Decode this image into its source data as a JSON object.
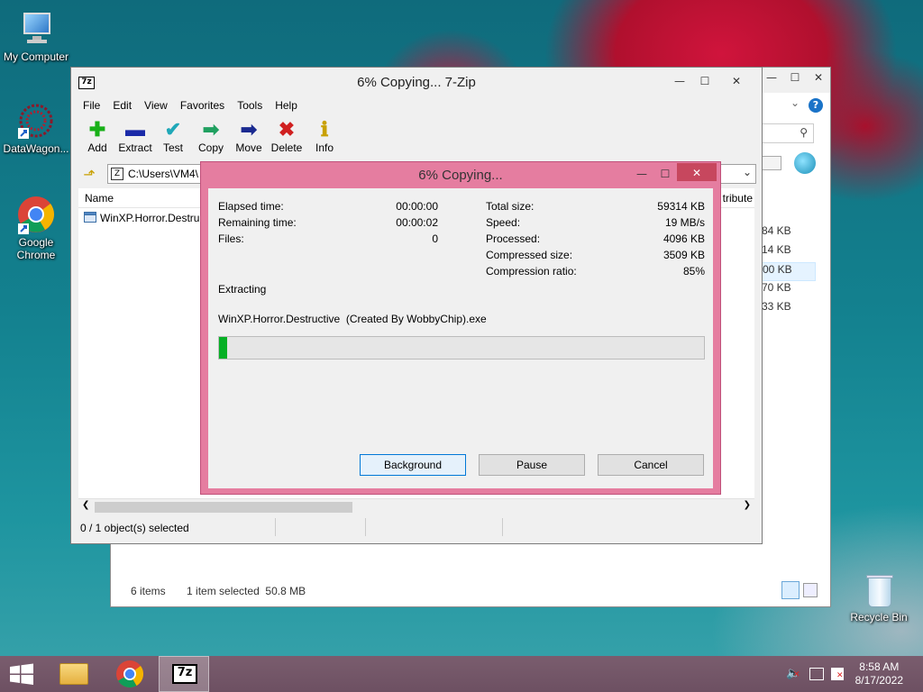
{
  "desktop": {
    "icons": [
      {
        "label": "My Computer"
      },
      {
        "label": "DataWagon..."
      },
      {
        "label": "Google Chrome"
      },
      {
        "label": "Recycle Bin"
      }
    ]
  },
  "explorer": {
    "sizes": [
      "84 KB",
      "14 KB",
      "00 KB",
      "70 KB",
      "33 KB"
    ],
    "status_items": "6 items",
    "status_selected": "1 item selected  50.8 MB"
  },
  "zip": {
    "title": "6% Copying... 7-Zip",
    "menu": [
      "File",
      "Edit",
      "View",
      "Favorites",
      "Tools",
      "Help"
    ],
    "toolbar": [
      {
        "label": "Add",
        "icon": "add-icon",
        "glyph": "✚",
        "color": "#18b018"
      },
      {
        "label": "Extract",
        "icon": "extract-icon",
        "glyph": "▬",
        "color": "#1a2aa8"
      },
      {
        "label": "Test",
        "icon": "test-icon",
        "glyph": "✔",
        "color": "#20a8b8"
      },
      {
        "label": "Copy",
        "icon": "copy-icon",
        "glyph": "➡",
        "color": "#20a060"
      },
      {
        "label": "Move",
        "icon": "move-icon",
        "glyph": "➡",
        "color": "#1a2a90"
      },
      {
        "label": "Delete",
        "icon": "delete-icon",
        "glyph": "✖",
        "color": "#d02020"
      },
      {
        "label": "Info",
        "icon": "info-icon",
        "glyph": "ℹ",
        "color": "#c8a000"
      }
    ],
    "address": "C:\\Users\\VM4\\",
    "col_name": "Name",
    "col_attr": "tribute",
    "file_name": "WinXP.Horror.Destruc",
    "status": "0 / 1 object(s) selected"
  },
  "dialog": {
    "title": "6% Copying...",
    "left_stats": [
      {
        "label": "Elapsed time:",
        "value": "00:00:00"
      },
      {
        "label": "Remaining time:",
        "value": "00:00:02"
      },
      {
        "label": "Files:",
        "value": "0"
      }
    ],
    "right_stats": [
      {
        "label": "Total size:",
        "value": "59314 KB"
      },
      {
        "label": "Speed:",
        "value": "19 MB/s"
      },
      {
        "label": "Processed:",
        "value": "4096 KB"
      },
      {
        "label": "Compressed size:",
        "value": "3509 KB"
      },
      {
        "label": "Compression ratio:",
        "value": "85%"
      }
    ],
    "operation": "Extracting",
    "current_file": "WinXP.Horror.Destructive  (Created By WobbyChip).exe",
    "progress_fraction": 0.016,
    "buttons": {
      "background": "Background",
      "pause": "Pause",
      "cancel": "Cancel"
    }
  },
  "taskbar": {
    "time": "8:58 AM",
    "date": "8/17/2022",
    "zip_label": "7z"
  },
  "colors": {
    "accent": "#e57da0",
    "progress": "#06b025"
  }
}
